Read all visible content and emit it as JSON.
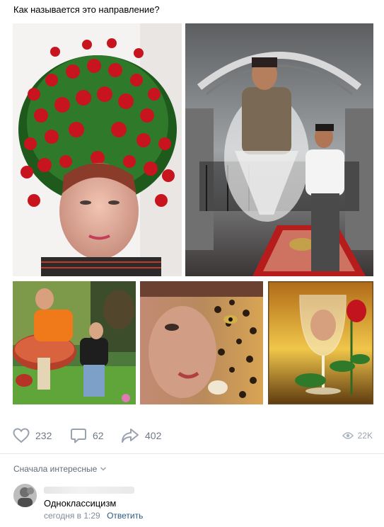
{
  "post": {
    "text": "Как называется это направление?"
  },
  "photos": [
    {
      "name": "photo-rose-wreath-woman"
    },
    {
      "name": "photo-genie-palace"
    },
    {
      "name": "photo-mushroom-forest"
    },
    {
      "name": "photo-woman-leopard"
    },
    {
      "name": "photo-wine-glass-rose"
    }
  ],
  "actions": {
    "likes": "232",
    "comments": "62",
    "shares": "402",
    "views": "22K"
  },
  "comments_section": {
    "sort_label": "Сначала интересные",
    "items": [
      {
        "text": "Одноклассицизм",
        "time": "сегодня в 1:29",
        "reply_label": "Ответить"
      }
    ]
  },
  "colors": {
    "icon": "#99a2ad",
    "link": "#2a5885",
    "muted": "#818c99"
  }
}
